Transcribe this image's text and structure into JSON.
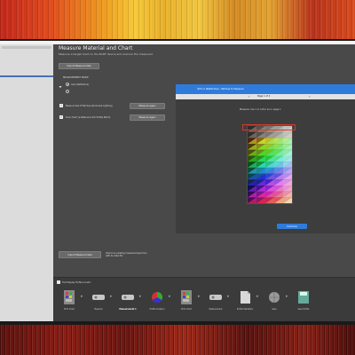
{
  "window": {
    "title": "Measure Material and Chart",
    "subtitle": "Measure a target chart on the BxDF device and scanner the measured"
  },
  "buttons": {
    "import_measure_file": "Import Measure Data",
    "measure_again_1": "Measure Again",
    "measure_again_2": "Measure Again",
    "import_measure_file_bottom": "Import Measure Data",
    "done": "Continue"
  },
  "measurement_mode": {
    "heading": "MEASUREMENT MODE",
    "options": [
      "Auto (Reflective)",
      ""
    ],
    "selected": 0
  },
  "checks": [
    {
      "label": "Measure Set of Patches (Dominant Lighting)",
      "checked": true
    },
    {
      "label": "Scan Chart (a Reference ICC Profile Patch)",
      "checked": true
    }
  ],
  "bottom_note": "Import an existing measured spectrum with its data file",
  "preview": {
    "title": "i1Pro 2 (Reflective) - Patches to Measure",
    "tab": "Page 1 of 1",
    "description": "Measure row 1 in order as in page 1",
    "nav_left": "‹",
    "nav_right": "›"
  },
  "colors": {
    "accent": "#2f7bdc",
    "highlight": "#d23b2a",
    "panel": "#494949",
    "sidebar": "#dcdcdc"
  },
  "workflow": {
    "checkbox_label": "Find Display Profile Locator",
    "steps": [
      {
        "label": "Print Chart",
        "icon": "chart-icon",
        "active": false
      },
      {
        "label": "Measure",
        "icon": "measure-device-icon",
        "active": false
      },
      {
        "label": "Measurement 1",
        "icon": "measure-device-icon",
        "active": true
      },
      {
        "label": "Profile Creation",
        "icon": "color-wheel-icon",
        "active": false
      },
      {
        "label": "Print Chart",
        "icon": "chart-icon",
        "active": false
      },
      {
        "label": "Measurement",
        "icon": "measure-device-icon",
        "active": false
      },
      {
        "label": "Profile Validation",
        "icon": "page-icon",
        "active": false
      },
      {
        "label": "Save",
        "icon": "globe-icon",
        "active": false
      },
      {
        "label": "Save Profile",
        "icon": "save-icon",
        "active": false
      }
    ]
  }
}
